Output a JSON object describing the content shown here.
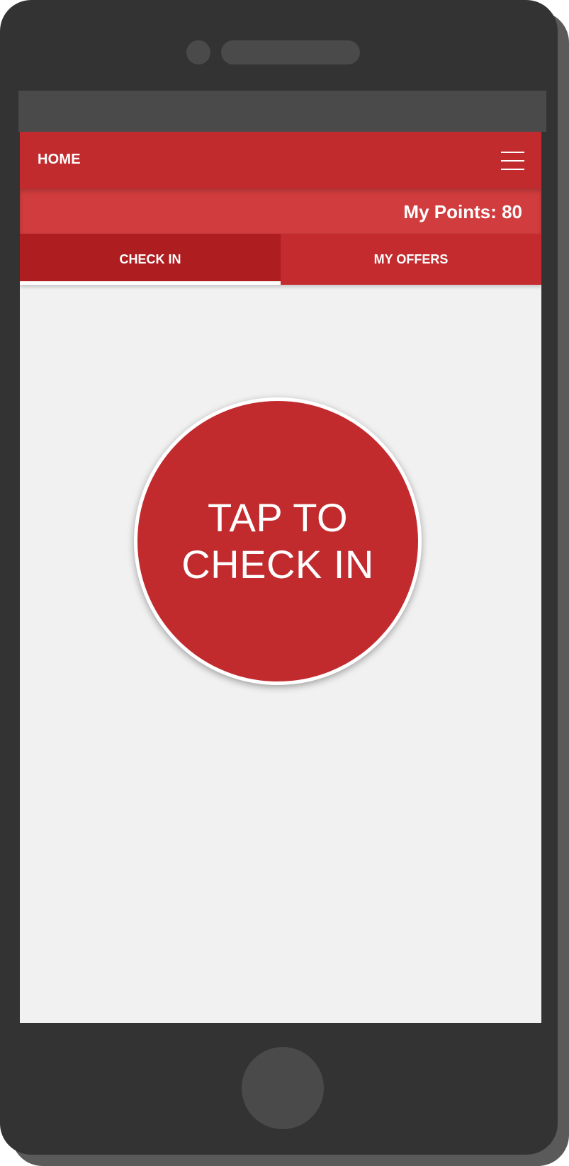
{
  "app_bar": {
    "title": "HOME",
    "menu_icon": "hamburger-menu-icon"
  },
  "points": {
    "label": "My Points: 80",
    "value": 80
  },
  "tabs": [
    {
      "label": "CHECK IN",
      "selected": true
    },
    {
      "label": "MY OFFERS",
      "selected": false
    }
  ],
  "checkin_button": {
    "line1": "TAP TO",
    "line2": "CHECK IN"
  },
  "colors": {
    "primary": "#c12b2e",
    "primary_dark": "#ae1d20",
    "points_bar": "#d13c3e",
    "content_background": "#f1f1f1",
    "device_body": "#333333"
  }
}
